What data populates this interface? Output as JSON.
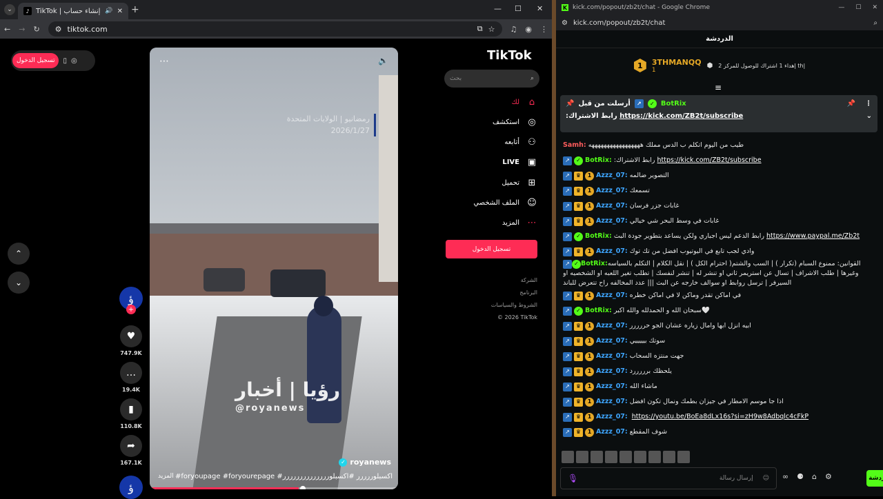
{
  "browser_left": {
    "tab_title": "TikTok | إنشاء حساب",
    "url": "tiktok.com",
    "controls": {
      "minimize": "—",
      "maximize": "☐",
      "close": "✕"
    }
  },
  "tiktok": {
    "logo": "TikTok",
    "search_placeholder": "بحث",
    "nav": [
      {
        "label": "لك",
        "icon": "home-icon"
      },
      {
        "label": "استكشف",
        "icon": "compass-icon"
      },
      {
        "label": "أتابعه",
        "icon": "following-icon"
      },
      {
        "label": "LIVE",
        "icon": "live-icon"
      },
      {
        "label": "تحميل",
        "icon": "upload-icon"
      },
      {
        "label": "الملف الشخصي",
        "icon": "profile-icon"
      },
      {
        "label": "المزيد",
        "icon": "more-icon"
      }
    ],
    "login_button": "تسجيل الدخول",
    "top_login": "تسجيل الدخول",
    "footer": [
      "الشركة",
      "البرنامج",
      "الشروط والسياسات",
      "© 2026 TikTok"
    ],
    "video": {
      "overlay_line1": "رمضانيو | الولايات المتحدة",
      "overlay_line2": "2026/1/27",
      "watermark_ar": "رؤيا | أخبار",
      "watermark_en": "@royanews",
      "author": "royanews",
      "caption": "#foryoupage #foryourepage #اكسبلوررررر #اكسبلورررررررررررررر",
      "more": "المزيد",
      "progress": 0.6
    },
    "actions": [
      {
        "icon": "heart-icon",
        "count": "747.9K"
      },
      {
        "icon": "comment-icon",
        "count": "19.4K"
      },
      {
        "icon": "bookmark-icon",
        "count": "110.8K"
      },
      {
        "icon": "share-icon",
        "count": "167.1K"
      }
    ]
  },
  "browser_right": {
    "window_title": "kick.com/popout/zb2t/chat - Google Chrome",
    "url": "kick.com/popout/zb2t/chat"
  },
  "kick": {
    "header": "الدردشة",
    "top_gifter": {
      "rank": "1",
      "name": "3THMANQQ",
      "count": "1",
      "note": "إهداء 1 اشتراك للوصول للمركز 2 th|"
    },
    "pinned": {
      "pinned_by": "أرسلت من قبل",
      "user": "BotRix",
      "label": ":رابط الاشتراك",
      "link": "https://kick.com/ZB2t/subscribe"
    },
    "messages": [
      {
        "type": "samh",
        "user": "Samh:",
        "text": "طيب من اليوم اتكلم ب الدس مملك هههههههههههههههههه"
      },
      {
        "type": "bot",
        "user": "BotRix:",
        "text": ":رابط الاشتراك ",
        "link": "https://kick.com/ZB2t/subscribe"
      },
      {
        "type": "azz",
        "user": "Azzz_07:",
        "text": "التصوير ضالمه"
      },
      {
        "type": "azz",
        "user": "Azzz_07:",
        "text": "تسمعك"
      },
      {
        "type": "azz",
        "user": "Azzz_07:",
        "text": "غابات جزر فرسان"
      },
      {
        "type": "azz",
        "user": "Azzz_07:",
        "text": "غابات في وسط البحر شي خيالي"
      },
      {
        "type": "bot",
        "user": "BotRix:",
        "text": "رابط الدعم ليس اجباري ولكن يساعد بتطوير جودة البث ",
        "link": "https://www.paypal.me/Zb2t"
      },
      {
        "type": "azz",
        "user": "Azzz_07:",
        "text": "وادي لجب تابع في اليوتيوب افضل من تك توك"
      },
      {
        "type": "botwrap",
        "user": "BotRix:",
        "text": "القوانين: ممنوع السبام (تكرار ) | السب والشتم( احترام الكل ) | نقل الكلام | التكلم بالسياسه وغيرها | طلب الاشراف | تسال عن استريمر ثاني او تنشر له | تنشر لنفسك | تطلب تغير اللعبه او الشخصيه او السيرفر | ترسل روابط او سوالف خارجه عن البث ||| عدد المخالفه راح تتعرض للباند"
      },
      {
        "type": "azz",
        "user": "Azzz_07:",
        "text": "في اماكن تقدر وماكن لا في اماكن خطره"
      },
      {
        "type": "bot",
        "user": "BotRix:",
        "text": "سبحان الله و الحمدلله والله اكبر🤍"
      },
      {
        "type": "azz",
        "user": "Azzz_07:",
        "text": "ابيه انزل ابها وامال زياره عشان الجو حررررر"
      },
      {
        "type": "azz",
        "user": "Azzz_07:",
        "text": "سوتك بيييييي"
      },
      {
        "type": "azz",
        "user": "Azzz_07:",
        "text": "جهت منتزه السحاب"
      },
      {
        "type": "azz",
        "user": "Azzz_07:",
        "text": "يلحظك برررررد"
      },
      {
        "type": "azz",
        "user": "Azzz_07:",
        "text": "ماشاء الله"
      },
      {
        "type": "azz",
        "user": "Azzz_07:",
        "text": "اذا جا موسم الامطار في جيزان بطمك ونمال تكون افضل"
      },
      {
        "type": "azz",
        "user": "Azzz_07:",
        "text": "",
        "link": "https://youtu.be/BoEa8dLx16s?si=zH9w8Adbqlc4cFkP"
      },
      {
        "type": "azz",
        "user": "Azzz_07:",
        "text": "شوف المقطع"
      }
    ],
    "composer_placeholder": "إرسال رسالة",
    "send": "الدردشة"
  }
}
